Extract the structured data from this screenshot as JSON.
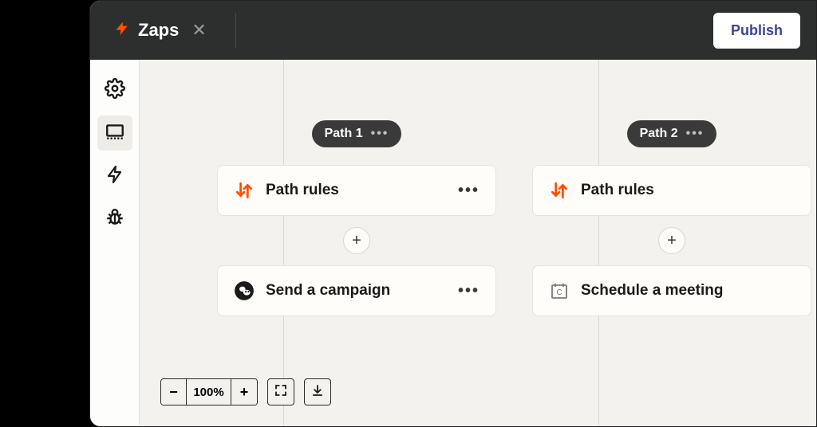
{
  "header": {
    "tab_title": "Zaps",
    "publish_label": "Publish"
  },
  "sidebar": {
    "items": [
      {
        "name": "settings"
      },
      {
        "name": "canvas"
      },
      {
        "name": "zap"
      },
      {
        "name": "debug"
      }
    ],
    "active": 1
  },
  "paths": [
    {
      "label": "Path 1",
      "nodes": [
        {
          "icon": "path-rules",
          "label": "Path rules",
          "show_more": true
        },
        {
          "icon": "mailchimp",
          "label": "Send a campaign",
          "show_more": true
        }
      ]
    },
    {
      "label": "Path 2",
      "nodes": [
        {
          "icon": "path-rules",
          "label": "Path rules",
          "show_more": false
        },
        {
          "icon": "calendar",
          "label": "Schedule a meeting",
          "show_more": false
        }
      ]
    }
  ],
  "zoom": {
    "value": "100%"
  },
  "colors": {
    "accent": "#ff4f00",
    "publish_text": "#3d4592"
  }
}
